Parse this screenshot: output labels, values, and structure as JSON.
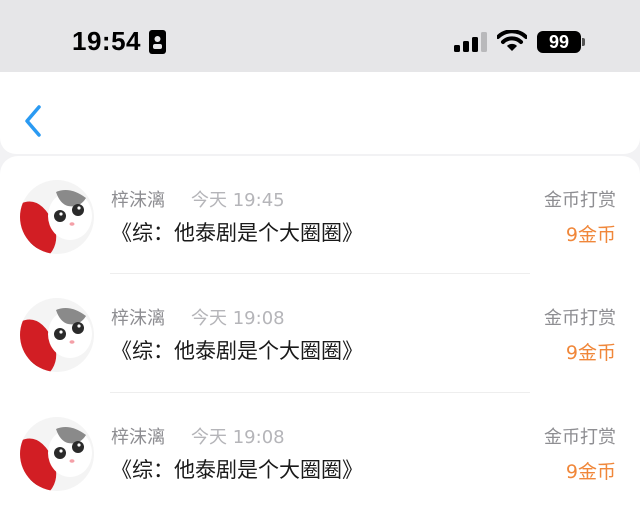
{
  "status_bar": {
    "time": "19:54",
    "battery": "99"
  },
  "nav": {
    "back_icon": "chevron-left-icon",
    "accent_color": "#2a9af2"
  },
  "records": [
    {
      "name": "梓沫漓",
      "time": "今天 19:45",
      "title": "《综：他泰剧是个大圈圈》",
      "reward_label": "金币打赏",
      "reward_value": "9金币"
    },
    {
      "name": "梓沫漓",
      "time": "今天 19:08",
      "title": "《综：他泰剧是个大圈圈》",
      "reward_label": "金币打赏",
      "reward_value": "9金币"
    },
    {
      "name": "梓沫漓",
      "time": "今天 19:08",
      "title": "《综：他泰剧是个大圈圈》",
      "reward_label": "金币打赏",
      "reward_value": "9金币"
    }
  ],
  "colors": {
    "reward": "#f0873a",
    "secondary_text": "#8e8e92"
  }
}
